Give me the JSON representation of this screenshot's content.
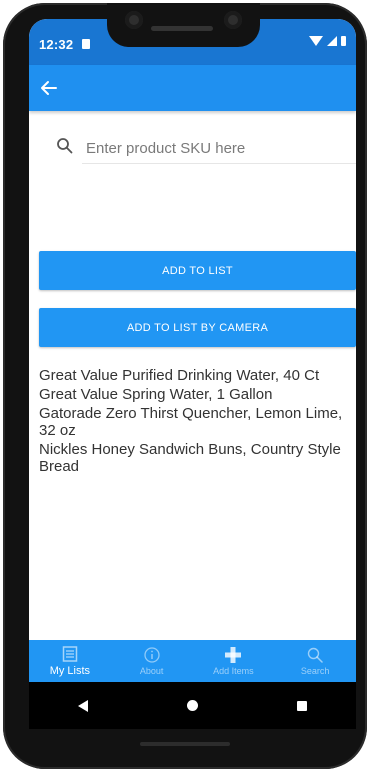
{
  "status_bar": {
    "time": "12:32"
  },
  "app_bar": {
    "back_icon": "arrow-left-icon"
  },
  "search": {
    "placeholder": "Enter product SKU here",
    "value": "",
    "icon": "search-icon"
  },
  "buttons": {
    "add_to_list": "ADD TO LIST",
    "add_by_camera": "ADD TO LIST BY CAMERA"
  },
  "products": [
    "Great Value Purified Drinking Water, 40 Ct",
    "Great Value Spring Water, 1 Gallon",
    "Gatorade Zero Thirst Quencher, Lemon Lime, 32 oz",
    "Nickles Honey Sandwich Buns, Country Style Bread"
  ],
  "bottom_nav": [
    {
      "label": "My Lists",
      "icon": "list-icon",
      "active": true
    },
    {
      "label": "About",
      "icon": "info-icon",
      "active": false
    },
    {
      "label": "Add Items",
      "icon": "plus-icon",
      "active": false
    },
    {
      "label": "Search",
      "icon": "search-icon",
      "active": false
    }
  ],
  "colors": {
    "status_bar": "#1976d2",
    "app_bar": "#1f90f0",
    "accent": "#2196f3"
  }
}
